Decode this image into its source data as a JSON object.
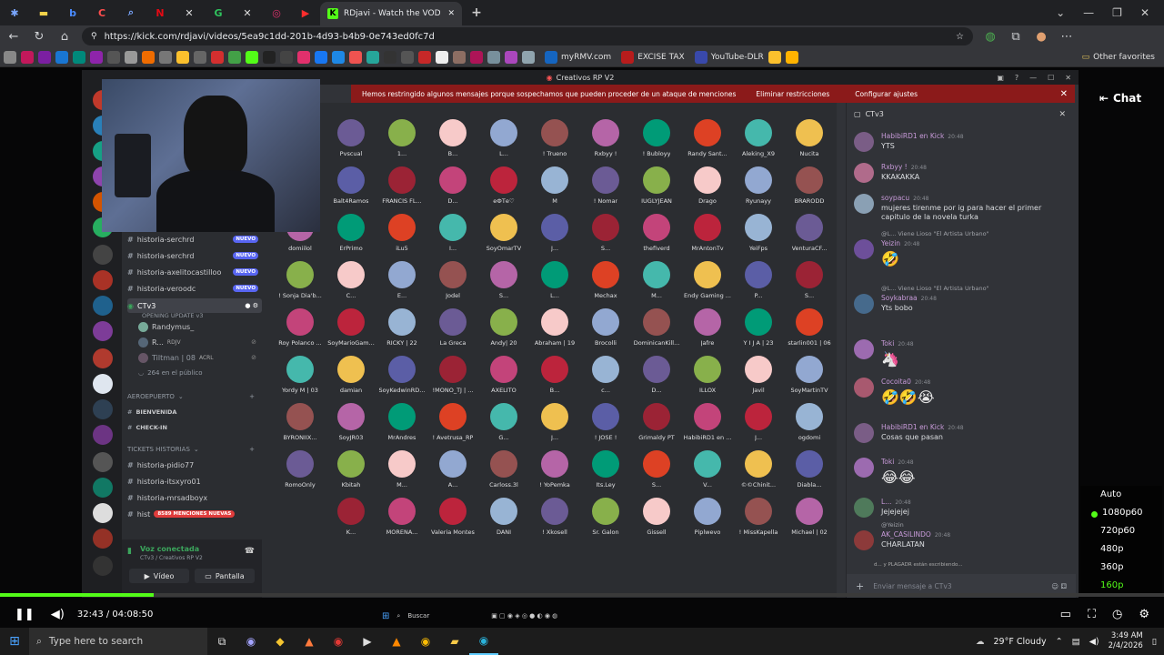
{
  "browser": {
    "active_tab_title": "RDjavi - Watch the VOD on Kick",
    "url": "https://kick.com/rdjavi/videos/5ea9c1dd-201b-4d93-b4b9-0e743ed0fc7d",
    "bookmarks": [
      {
        "label": "myRMV.com"
      },
      {
        "label": "EXCISE TAX"
      },
      {
        "label": "YouTube-DLR"
      }
    ],
    "other_bookmarks": "Other favorites"
  },
  "discord": {
    "window_title": "Creativos RP V2",
    "banner_text": "Hemos restringido algunos mensajes porque sospechamos que pueden proceder de un ataque de menciones",
    "banner_action_1": "Eliminar restricciones",
    "banner_action_2": "Configurar ajustes",
    "channels": [
      {
        "name": "historia-serchrd",
        "badge": "NUEVO"
      },
      {
        "name": "historia-serchrd",
        "badge": "NUEVO"
      },
      {
        "name": "historia-axelitocastilloo",
        "badge": "NUEVO"
      },
      {
        "name": "historia-veroodc",
        "badge": "NUEVO"
      }
    ],
    "voice_channel": "CTv3",
    "voice_subtitle": "OPENING UPDATE v3",
    "voice_members": [
      "Randymus_",
      "R...",
      "Tiltman | 08"
    ],
    "voice_tag_1": "RDJV",
    "voice_tag_2": "ACRL",
    "audience": "264 en el público",
    "category_1": "AEROEPUERTO",
    "sub_1": "BIENVENIDA",
    "sub_2": "CHECK-IN",
    "category_2": "TICKETS HISTORIAS",
    "tickets": [
      "historia-pidio77",
      "historia-itsxyro01",
      "historia-mrsadboyx",
      "hist"
    ],
    "mentions_badge": "8589 MENCIONES NUEVAS",
    "nuevo_small": "NUEVO",
    "voice_connected": "Voz conectada",
    "voice_connected_sub": "CTv3 / Creativos RP V2",
    "video_btn": "Vídeo",
    "screen_btn": "Pantalla",
    "user_name": "R...",
    "user_status": "En un escenario",
    "grid_names": [
      "Pvscual",
      "1...",
      "B...",
      "L...",
      "! Trueno",
      "Rxbyy !",
      "! Bubloyy",
      "Randy Sant...",
      "Aleking_X9",
      "Nucita",
      "Balt4Ramos",
      "FRANCIS FL...",
      "D...",
      "еФТе♡",
      "M",
      "! Nomar",
      "IUGLYJEAN",
      "Drago",
      "Ryunayy",
      "BRARODD",
      "domiilol",
      "ErPrimo",
      "iLu5",
      "I...",
      "SoyOmarTV",
      "J...",
      "S...",
      "thefiverd",
      "MrAntonTv",
      "YeiFps",
      "VenturaCF...",
      "! Sonja Dia'b...",
      "C...",
      "E...",
      "Jodel",
      "S...",
      "L...",
      "Mechax",
      "M...",
      "Endy Gaming ...",
      "P...",
      "S...",
      "Roy Polanco ...",
      "SoyMarioGam...",
      "RICKY | 22",
      "La Greca",
      "Andy| 20",
      "Abraham | 19",
      "Brocolli",
      "DominicanKill...",
      "Jafre",
      "Y I J A | 23",
      "starlin001 | 06",
      "Yordy M | 03",
      "damian",
      "SoyKedwinRD...",
      "!MONO_TJ | ...",
      "AXELITO",
      "B...",
      "c...",
      "D...",
      "ILLOX",
      "Javil",
      "SoyMartinTV",
      "BYRONIIX...",
      "SoyJR03",
      "MrAndres",
      "! Avetrusa_RP",
      "G...",
      "J...",
      "! JOSE !",
      "Grimaldy PT",
      "HabibiRD1 en ...",
      "J...",
      "ogdomi",
      "RomoOnly",
      "Kbitah",
      "M...",
      "A...",
      "Carloss.3l",
      "! YoPemka",
      "Its.Ley",
      "S...",
      "V...",
      "©©Chinit...",
      "Diabla...",
      "K...",
      "MORENA...",
      "Valeria Montes",
      "DANI",
      "! Xkosell",
      "Sr. Galon",
      "Gissell",
      "Piplwevo",
      "! MissKapella",
      "Michael | 02"
    ],
    "chat_channel": "CTv3",
    "chat_messages": [
      {
        "user": "HabibiRD1 en Kick",
        "time": "20:48",
        "text": "YTS"
      },
      {
        "user": "Rxbyy !",
        "time": "20:48",
        "text": "KKAKAKKA"
      },
      {
        "user": "soypacu",
        "time": "20:48",
        "text": "mujeres tirenme por ig para hacer el primer capitulo de la novela turka"
      },
      {
        "user": "Yeizin",
        "time": "20:48",
        "reply": "@L... Viene Lioso \"El Artista Urbano\"",
        "emoji": "🤣"
      },
      {
        "user": "Soykabraa",
        "time": "20:48",
        "reply": "@L... Viene Lioso \"El Artista Urbano\"",
        "text": "Yts bobo"
      },
      {
        "user": "Toki",
        "time": "20:48",
        "emoji": "🦄"
      },
      {
        "user": "Cocoita0",
        "time": "20:48",
        "emoji": "🤣🤣😭"
      },
      {
        "user": "HabibiRD1 en Kick",
        "time": "20:48",
        "text": "Cosas que pasan"
      },
      {
        "user": "Toki",
        "time": "20:48",
        "emoji": "😂😂"
      },
      {
        "user": "L...",
        "time": "20:48",
        "text": "Jejejejej"
      },
      {
        "user": "AK_CASILINDO",
        "time": "20:48",
        "reply": "@Yeizin",
        "text": "CHARLATAN"
      }
    ],
    "typing": "d... y PLAGADR están escribiendo...",
    "chat_placeholder": "Enviar mensaje a CTv3"
  },
  "kick": {
    "chat_button": "Chat",
    "quality_options": [
      "Auto",
      "1080p60",
      "720p60",
      "480p",
      "360p",
      "160p"
    ],
    "selected_quality": "1080p60",
    "time_display": "32:43 / 04:08:50",
    "progress": 0.132
  },
  "video_taskbar": {
    "search": "Buscar"
  },
  "taskbar": {
    "search_placeholder": "Type here to search",
    "weather": "29°F  Cloudy",
    "time": "3:49 AM",
    "date": "2/4/2026"
  },
  "colors": {
    "kick_green": "#53fc18",
    "discord_bg": "#313338",
    "banner_red": "#8b1a1a",
    "badge_blue": "#5865f2"
  }
}
